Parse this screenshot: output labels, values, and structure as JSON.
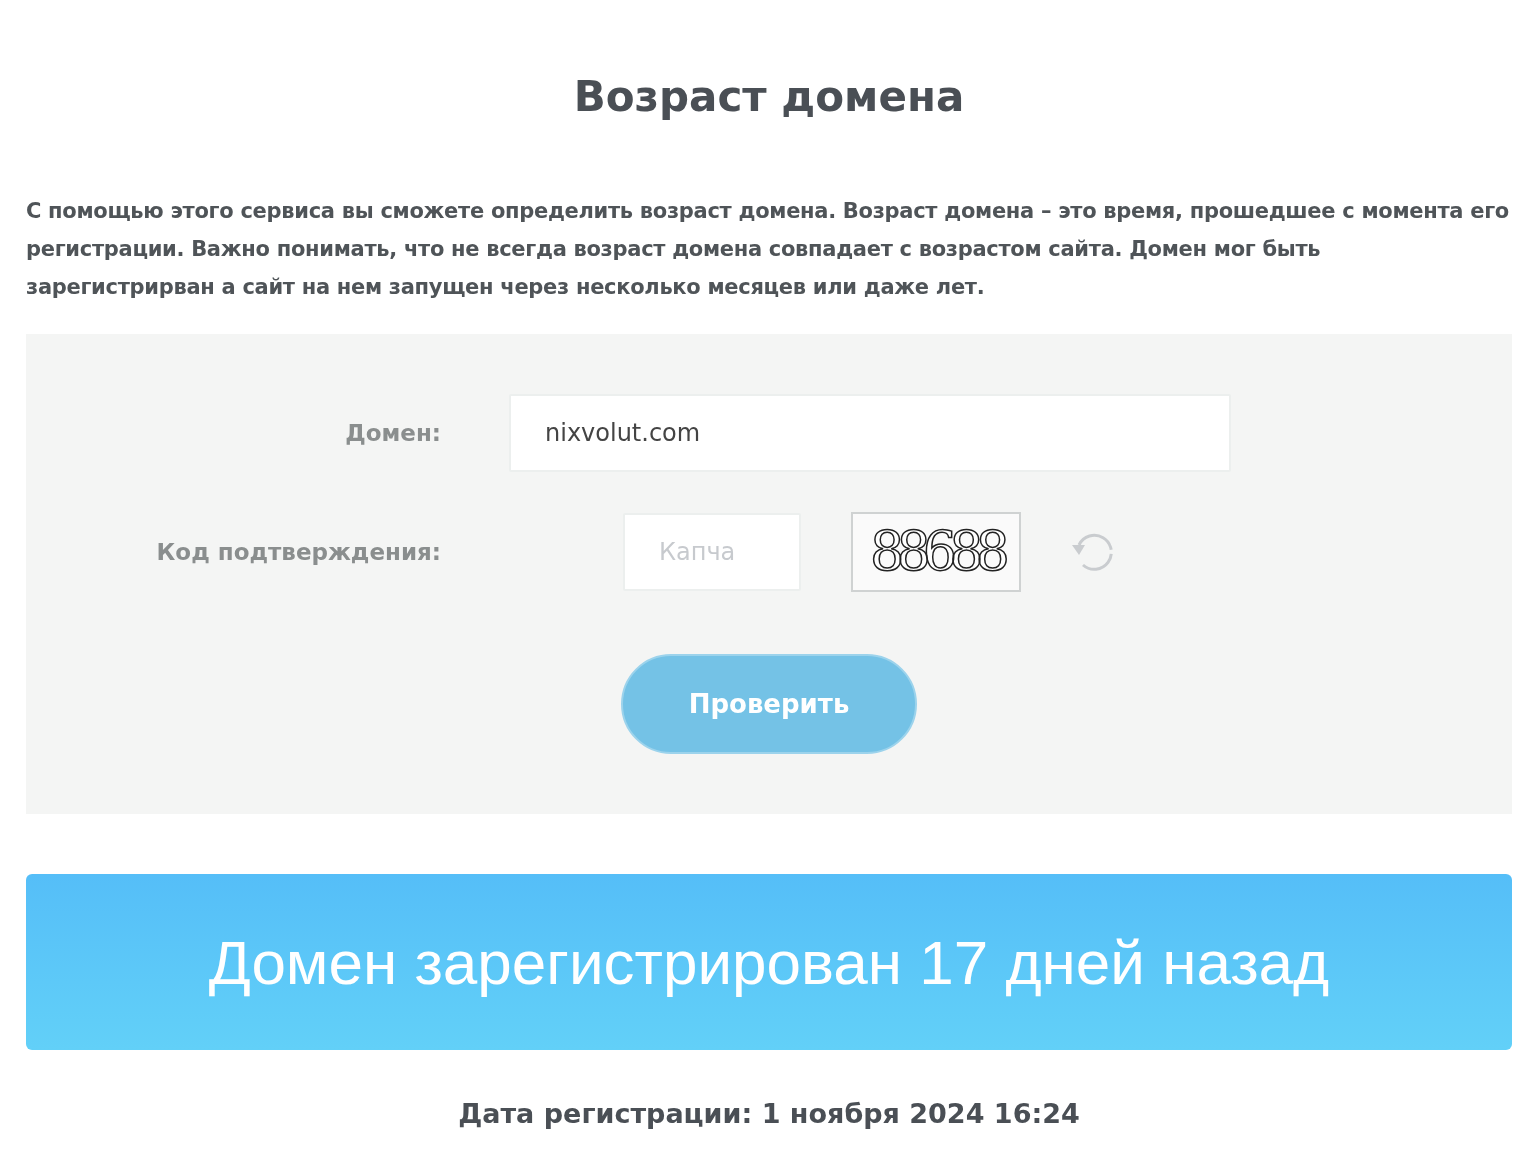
{
  "title": "Возраст домена",
  "description": "С помощью этого сервиса вы сможете определить возраст домена. Возраст домена – это время, прошедшее с момента его регистрации. Важно понимать, что не всегда возраст домена совпадает с возрастом сайта. Домен мог быть зарегистрирван а сайт на нем запущен через несколько месяцев или даже лет.",
  "form": {
    "domain": {
      "label": "Домен:",
      "value": "nixvolut.com"
    },
    "captcha": {
      "label": "Код подтверждения:",
      "placeholder": "Капча",
      "code": "88688"
    },
    "submit": "Проверить"
  },
  "result": "Домен зарегистрирован 17 дней назад",
  "registration_date": "Дата регистрации: 1 ноября 2024 16:24"
}
